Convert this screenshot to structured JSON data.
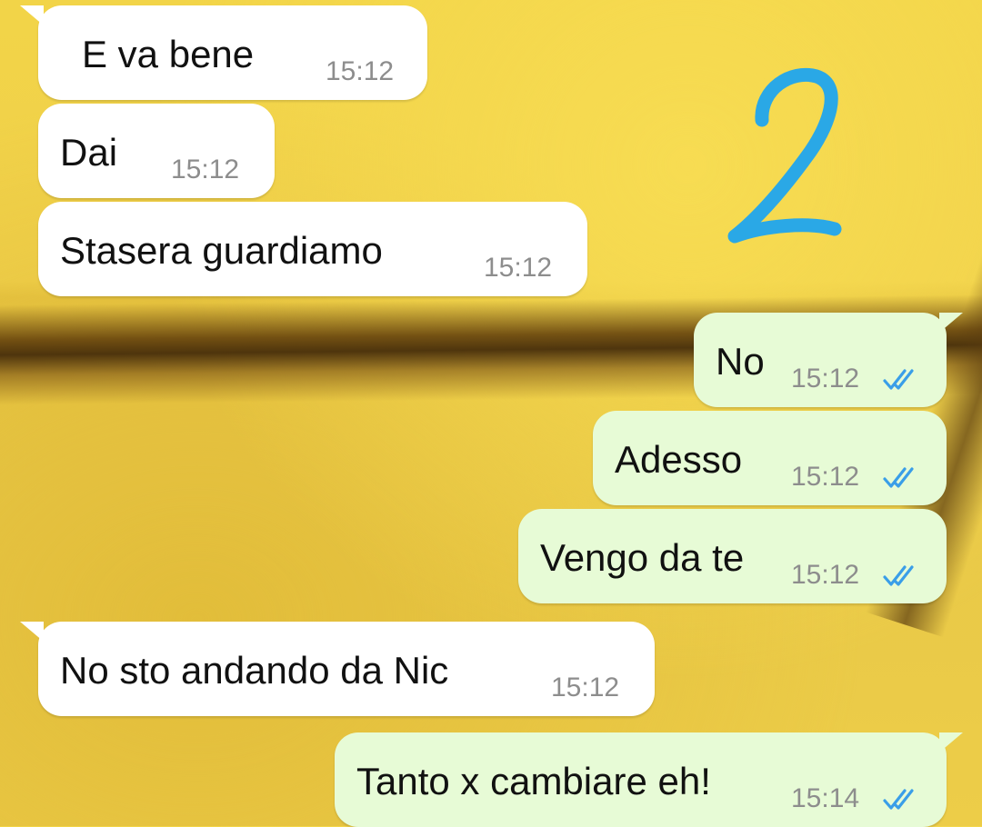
{
  "annotation": {
    "mark": "2"
  },
  "colors": {
    "incoming_bubble": "#ffffff",
    "outgoing_bubble": "#e7fbd6",
    "read_ticks": "#3a9ee8",
    "mark": "#2aa8e6"
  },
  "messages": [
    {
      "direction": "incoming",
      "text": "E va bene",
      "time": "15:12"
    },
    {
      "direction": "incoming",
      "text": "Dai",
      "time": "15:12"
    },
    {
      "direction": "incoming",
      "text": "Stasera guardiamo",
      "time": "15:12"
    },
    {
      "direction": "outgoing",
      "text": "No",
      "time": "15:12",
      "status": "read-double-check-icon"
    },
    {
      "direction": "outgoing",
      "text": "Adesso",
      "time": "15:12",
      "status": "read-double-check-icon"
    },
    {
      "direction": "outgoing",
      "text": "Vengo da te",
      "time": "15:12",
      "status": "read-double-check-icon"
    },
    {
      "direction": "incoming",
      "text": "No sto andando da Nic",
      "time": "15:12"
    },
    {
      "direction": "outgoing",
      "text": "Tanto x cambiare eh!",
      "time": "15:14",
      "status": "read-double-check-icon"
    }
  ]
}
